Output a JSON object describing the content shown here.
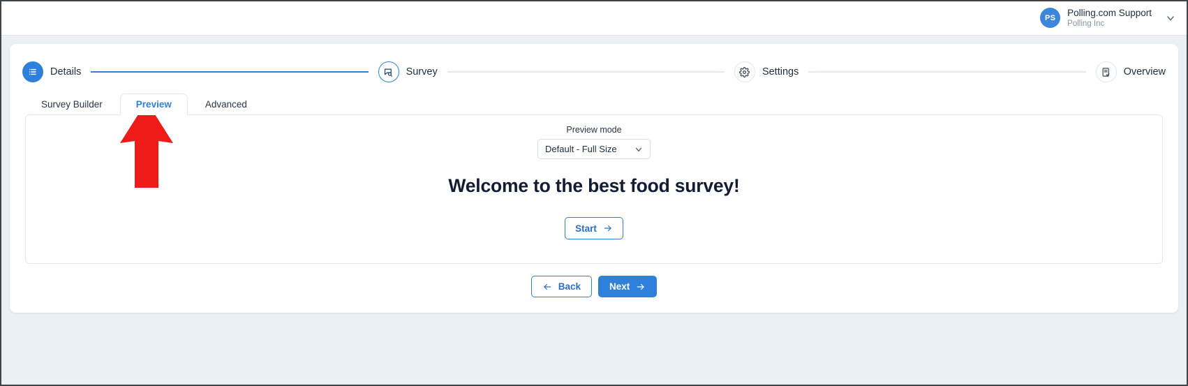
{
  "header": {
    "user": {
      "avatar_initials": "PS",
      "name": "Polling.com Support",
      "organization": "Polling Inc",
      "caret_icon": "chevron-down-icon"
    }
  },
  "stepper": {
    "steps": [
      {
        "label": "Details",
        "state": "done",
        "icon": "list-icon"
      },
      {
        "label": "Survey",
        "state": "current",
        "icon": "survey-search-icon"
      },
      {
        "label": "Settings",
        "state": "todo",
        "icon": "gear-icon"
      },
      {
        "label": "Overview",
        "state": "todo",
        "icon": "clipboard-check-icon"
      }
    ],
    "connector_active_color": "#2f80da",
    "connector_inactive_color": "#e3e9f1"
  },
  "tabs": {
    "items": [
      {
        "label": "Survey Builder",
        "active": false
      },
      {
        "label": "Preview",
        "active": true
      },
      {
        "label": "Advanced",
        "active": false
      }
    ],
    "active_color": "#2f80da"
  },
  "preview": {
    "mode_label": "Preview mode",
    "mode_value": "Default - Full Size",
    "mode_caret_icon": "chevron-down-icon",
    "welcome_heading": "Welcome to the best food survey!",
    "start_button": {
      "label": "Start",
      "icon": "arrow-right-icon"
    }
  },
  "footer": {
    "back_button": {
      "label": "Back",
      "icon": "arrow-left-icon"
    },
    "next_button": {
      "label": "Next",
      "icon": "arrow-right-icon"
    }
  },
  "annotation": {
    "arrow": {
      "name": "red-up-arrow",
      "color": "#ee1b18",
      "points_at": "Preview"
    }
  },
  "colors": {
    "accent_blue": "#2f80da",
    "avatar_blue": "#3c87dd",
    "page_background": "#ebf0f5",
    "card_background": "#ffffff",
    "heading_text": "#131c33"
  }
}
